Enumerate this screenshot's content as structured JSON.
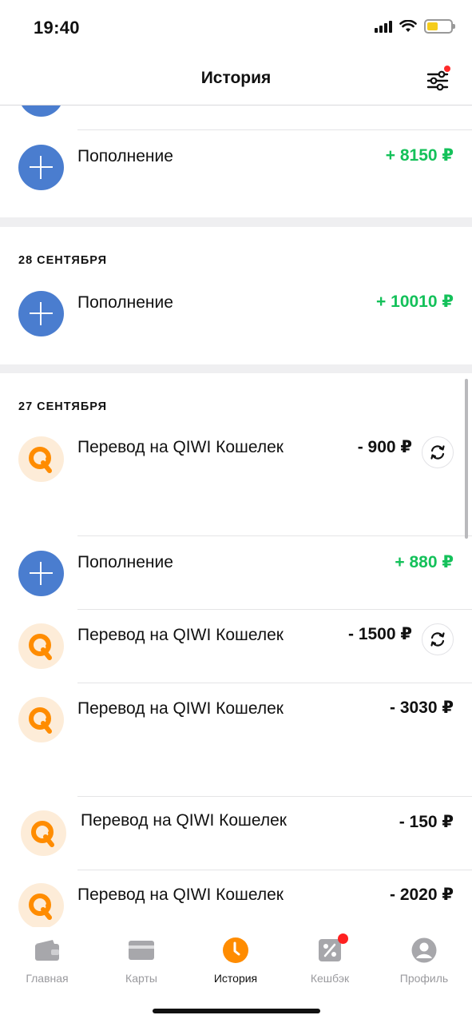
{
  "status_bar": {
    "time": "19:40"
  },
  "header": {
    "title": "История"
  },
  "groups": [
    {
      "date": "",
      "items": [
        {
          "type": "topup",
          "title": "Пополнение",
          "amount": "+ 8150 ₽",
          "repeat": false
        }
      ]
    },
    {
      "date": "28 СЕНТЯБРЯ",
      "items": [
        {
          "type": "topup",
          "title": "Пополнение",
          "amount": "+ 10010 ₽",
          "repeat": false
        }
      ]
    },
    {
      "date": "27 СЕНТЯБРЯ",
      "items": [
        {
          "type": "transfer",
          "title": "Перевод на QIWI Кошелек",
          "amount": "- 900 ₽",
          "repeat": true
        },
        {
          "type": "topup",
          "title": "Пополнение",
          "amount": "+ 880 ₽",
          "repeat": false
        },
        {
          "type": "transfer",
          "title": "Перевод на QIWI Кошелек",
          "amount": "- 1500 ₽",
          "repeat": true
        },
        {
          "type": "transfer",
          "title": "Перевод на QIWI Кошелек",
          "amount": "- 3030 ₽",
          "repeat": false
        },
        {
          "type": "transfer",
          "title": "Перевод на QIWI Кошелек",
          "amount": "- 150 ₽",
          "repeat": false
        },
        {
          "type": "transfer",
          "title": "Перевод на QIWI Кошелек",
          "amount": "- 2020 ₽",
          "repeat": false
        }
      ]
    }
  ],
  "tabs": [
    {
      "label": "Главная",
      "icon": "wallet-icon",
      "active": false
    },
    {
      "label": "Карты",
      "icon": "card-icon",
      "active": false
    },
    {
      "label": "История",
      "icon": "clock-icon",
      "active": true
    },
    {
      "label": "Кешбэк",
      "icon": "percent-icon",
      "active": false,
      "badge": true
    },
    {
      "label": "Профиль",
      "icon": "profile-icon",
      "active": false
    }
  ],
  "colors": {
    "positive_amount": "#14c15a",
    "topup_icon": "#4a7dcf",
    "qiwi_orange": "#ff8c00",
    "active_tab": "#ff8c00"
  }
}
